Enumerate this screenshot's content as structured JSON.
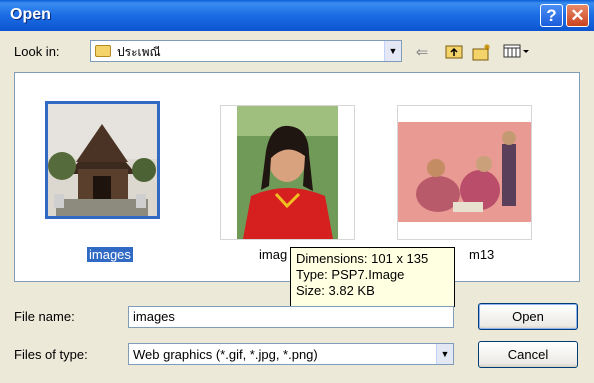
{
  "window": {
    "title": "Open",
    "help_glyph": "?",
    "close_glyph": "✕"
  },
  "look_in": {
    "label": "Look in:",
    "value": "ประเพณี"
  },
  "toolbar": {
    "icons": [
      "back-icon",
      "up-folder-icon",
      "new-folder-icon",
      "views-menu-icon"
    ]
  },
  "files": [
    {
      "name": "images",
      "selected": true
    },
    {
      "name": "imag",
      "selected": false
    },
    {
      "name": "m13",
      "selected": false
    }
  ],
  "tooltip": {
    "dimensions": "Dimensions: 101 x 135",
    "type": "Type: PSP7.Image",
    "size": "Size: 3.82 KB"
  },
  "file_name": {
    "label": "File name:",
    "value": "images"
  },
  "files_of_type": {
    "label": "Files of type:",
    "value": "Web graphics (*.gif, *.jpg, *.png)"
  },
  "buttons": {
    "open": "Open",
    "cancel": "Cancel"
  },
  "colors": {
    "titlebar": "#0b55d0",
    "selection": "#316ac5",
    "tooltip_bg": "#ffffe1"
  }
}
